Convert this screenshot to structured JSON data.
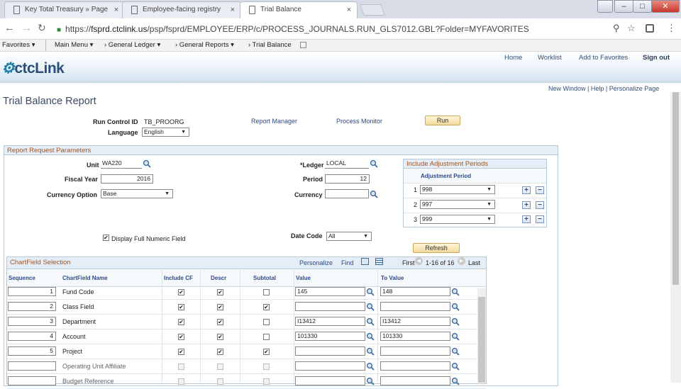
{
  "browser": {
    "tabs": [
      {
        "title": "Key Total Treasury » Page",
        "close": "×"
      },
      {
        "title": "Employee-facing registry",
        "close": "×"
      },
      {
        "title": "Trial Balance",
        "close": "×"
      }
    ],
    "url_scheme": "https://",
    "url_host": "fsprd.ctclink.us",
    "url_path": "/psp/fsprd/EMPLOYEE/ERP/c/PROCESS_JOURNALS.RUN_GLS7012.GBL?Folder=MYFAVORITES",
    "window_buttons": [
      "–",
      "□",
      "✕"
    ]
  },
  "psnav": {
    "items": [
      "Favorites ▾",
      "Main Menu ▾",
      "›  General Ledger ▾",
      "›  General Reports ▾",
      "›  Trial Balance"
    ]
  },
  "header": {
    "logo_prefix": "⚙",
    "logo_text": "ctcLink",
    "links": [
      "Home",
      "Worklist",
      "Add to Favorites",
      "Sign out"
    ]
  },
  "utility_links": "New Window | Help | Personalize Page",
  "page": {
    "title": "Trial Balance Report",
    "run_control_label": "Run Control ID",
    "run_control_value": "TB_PROORG",
    "language_label": "Language",
    "language_value": "English",
    "report_manager": "Report Manager",
    "process_monitor": "Process Monitor",
    "run_button": "Run"
  },
  "request": {
    "title": "Report Request Parameters",
    "unit_label": "Unit",
    "unit_value": "WA220",
    "fiscal_year_label": "Fiscal Year",
    "fiscal_year_value": "2016",
    "currency_option_label": "Currency Option",
    "currency_option_value": "Base",
    "ledger_label": "*Ledger",
    "ledger_value": "LOCAL",
    "period_label": "Period",
    "period_value": "12",
    "currency_label": "Currency",
    "currency_value": "",
    "display_full_label": "Display Full Numeric Field",
    "date_code_label": "Date Code",
    "date_code_value": "All",
    "refresh_button": "Refresh"
  },
  "adjustment": {
    "title": "Include Adjustment Periods",
    "column": "Adjustment Period",
    "rows": [
      {
        "num": "1",
        "value": "998"
      },
      {
        "num": "2",
        "value": "997"
      },
      {
        "num": "3",
        "value": "999"
      }
    ]
  },
  "chartfield": {
    "title": "ChartField Selection",
    "nav": {
      "personalize": "Personalize",
      "find": "Find",
      "first": "First",
      "range": "1-16 of 16",
      "last": "Last"
    },
    "columns": [
      "Sequence",
      "ChartField Name",
      "Include CF",
      "Descr",
      "Subtotal",
      "Value",
      "To Value"
    ],
    "rows": [
      {
        "seq": "1",
        "name": "Fund Code",
        "include": true,
        "descr": true,
        "subtotal": false,
        "value": "145",
        "to_value": "148",
        "enabled": true
      },
      {
        "seq": "2",
        "name": "Class Field",
        "include": true,
        "descr": true,
        "subtotal": true,
        "value": "",
        "to_value": "",
        "enabled": true
      },
      {
        "seq": "3",
        "name": "Department",
        "include": true,
        "descr": true,
        "subtotal": false,
        "value": "I13412",
        "to_value": "I13412",
        "enabled": true
      },
      {
        "seq": "4",
        "name": "Account",
        "include": true,
        "descr": true,
        "subtotal": false,
        "value": "101330",
        "to_value": "101330",
        "enabled": true
      },
      {
        "seq": "5",
        "name": "Project",
        "include": true,
        "descr": true,
        "subtotal": true,
        "value": "",
        "to_value": "",
        "enabled": true
      },
      {
        "seq": "",
        "name": "Operating Unit Affiliate",
        "include": false,
        "descr": false,
        "subtotal": false,
        "value": "",
        "to_value": "",
        "enabled": false
      },
      {
        "seq": "",
        "name": "Budget Reference",
        "include": false,
        "descr": false,
        "subtotal": false,
        "value": "",
        "to_value": "",
        "enabled": false
      }
    ]
  }
}
